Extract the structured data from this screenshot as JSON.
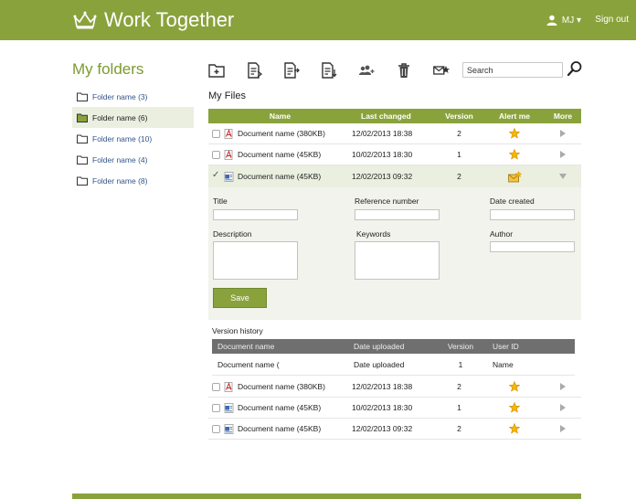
{
  "header": {
    "brand": "Work Together",
    "user": "MJ ▾",
    "sign_out": "Sign out"
  },
  "sidebar": {
    "title": "My folders",
    "folders": [
      {
        "label": "Folder name (3)"
      },
      {
        "label": "Folder name (6)"
      },
      {
        "label": "Folder name (10)"
      },
      {
        "label": "Folder name (4)"
      },
      {
        "label": "Folder name (8)"
      }
    ]
  },
  "toolbar": {
    "icons": [
      "new-folder-icon",
      "add-document-icon",
      "export-document-icon",
      "download-document-icon",
      "share-users-icon",
      "delete-icon",
      "mail-alert-icon"
    ],
    "search_placeholder": "Search"
  },
  "files": {
    "title": "My Files",
    "columns": {
      "name": "Name",
      "last_changed": "Last changed",
      "version": "Version",
      "alert": "Alert me",
      "more": "More"
    },
    "rows": [
      {
        "name": "Document name (380KB)",
        "date": "12/02/2013 18:38",
        "version": "2",
        "icon": "pdf-file-icon"
      },
      {
        "name": "Document name (45KB)",
        "date": "10/02/2013 18:30",
        "version": "1",
        "icon": "pdf-file-icon"
      },
      {
        "name": "Document name (45KB)",
        "date": "12/02/2013 09:32",
        "version": "2",
        "icon": "word-file-icon",
        "selected": true
      }
    ]
  },
  "detail": {
    "title_label": "Title",
    "reference_label": "Reference number",
    "date_created_label": "Date created",
    "description_label": "Description",
    "keywords_label": "Keywords",
    "author_label": "Author",
    "save_label": "Save"
  },
  "version_history": {
    "title": "Version history",
    "columns": {
      "name": "Document name",
      "date": "Date uploaded",
      "version": "Version",
      "user": "User ID"
    },
    "row": {
      "name": "Document name (",
      "date": "Date uploaded",
      "version": "1",
      "user": "Name"
    }
  },
  "more_files": {
    "rows": [
      {
        "name": "Document name (380KB)",
        "date": "12/02/2013 18:38",
        "version": "2",
        "icon": "pdf-file-icon"
      },
      {
        "name": "Document name (45KB)",
        "date": "10/02/2013 18:30",
        "version": "1",
        "icon": "word-file-icon"
      },
      {
        "name": "Document name (45KB)",
        "date": "12/02/2013 09:32",
        "version": "2",
        "icon": "word-file-icon"
      }
    ]
  },
  "colors": {
    "brand_green": "#8aa23c",
    "selection_bg": "#ebefe0",
    "link_blue": "#34558b",
    "history_header": "#6f6f6f",
    "star": "#f5b800"
  }
}
